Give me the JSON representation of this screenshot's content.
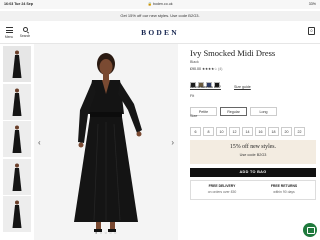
{
  "status_bar": {
    "time": "16:03",
    "date": "Tue 24 Sep",
    "url": "🔒 boden.co.uk",
    "battery": "33%"
  },
  "promo": {
    "text": "Get 15% off our new styles. Use code B2G3."
  },
  "header": {
    "menu_label": "Menu",
    "search_label": "Search",
    "logo": "BODEN",
    "bag_count": "0"
  },
  "gallery": {
    "thumbnails": [
      "photo-1",
      "photo-2",
      "photo-3",
      "photo-4",
      "photo-5"
    ],
    "active_index": 0,
    "carousel_dots": "● ○ ○ ○ ○",
    "prev_arrow": "‹",
    "next_arrow": "›"
  },
  "product": {
    "title": "Ivy Smocked Midi Dress",
    "color_name": "Black",
    "price": "£90.00",
    "rating_stars": "★★★★☆",
    "rating_count": "(4)",
    "swatches": [
      "#1c1c1c",
      "#6b5a3e",
      "#2b3a66",
      "#151515"
    ],
    "links": {
      "which_size": "Which size fits me?",
      "size_guide": "Size guide"
    },
    "fit_label": "Fit",
    "fits": [
      {
        "label": "Petite",
        "selected": false
      },
      {
        "label": "Regular",
        "selected": true
      },
      {
        "label": "Long",
        "selected": false
      }
    ],
    "size_label": "Size",
    "sizes": [
      "6",
      "8",
      "10",
      "12",
      "14",
      "16",
      "18",
      "20",
      "22"
    ]
  },
  "offer": {
    "title": "15% off new styles.",
    "code_line": "Use code B2G3"
  },
  "add_to_bag": {
    "label": "ADD TO BAG"
  },
  "delivery": {
    "free_delivery": "FREE DELIVERY",
    "free_delivery_sub": "on orders over £50",
    "free_returns": "FREE RETURNS",
    "free_returns_sub": "within 90 days"
  },
  "colors": {
    "logo": "#16254f",
    "offer_bg": "#f3ece1",
    "chat": "#1f7a3d"
  }
}
